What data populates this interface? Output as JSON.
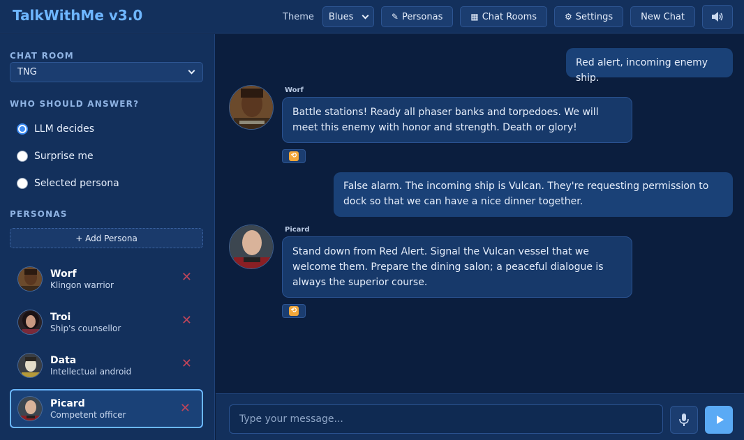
{
  "app": {
    "title": "TalkWithMe v3.0"
  },
  "header": {
    "theme_label": "Theme",
    "theme_value": "Blues",
    "personas_btn": "Personas",
    "chatrooms_btn": "Chat Rooms",
    "settings_btn": "Settings",
    "newchat_btn": "New Chat",
    "icons": {
      "personas": "pencil-icon",
      "chatrooms": "building-icon",
      "settings": "gear-icon",
      "sound": "speaker-icon"
    }
  },
  "sidebar": {
    "chat_room_title": "CHAT ROOM",
    "chat_room_value": "TNG",
    "who_title": "WHO SHOULD ANSWER?",
    "answer_options": [
      {
        "label": "LLM decides",
        "checked": true
      },
      {
        "label": "Surprise me",
        "checked": false
      },
      {
        "label": "Selected persona",
        "checked": false
      }
    ],
    "personas_title": "PERSONAS",
    "add_persona": "+ Add Persona",
    "personas": [
      {
        "name": "Worf",
        "desc": "Klingon warrior"
      },
      {
        "name": "Troi",
        "desc": "Ship's counsellor"
      },
      {
        "name": "Data",
        "desc": "Intellectual android"
      },
      {
        "name": "Picard",
        "desc": "Competent officer"
      }
    ],
    "remove_glyph": "✕"
  },
  "messages": [
    {
      "role": "user",
      "text": "Red alert, incoming enemy ship."
    },
    {
      "role": "bot",
      "sender": "Worf",
      "text": "Battle stations! Ready all phaser banks and torpedoes. We will meet this enemy with honor and strength. Death or glory!"
    },
    {
      "role": "user",
      "text": "False alarm. The incoming ship is Vulcan. They're requesting permission to dock so that we can have a nice dinner together."
    },
    {
      "role": "bot",
      "sender": "Picard",
      "text": "Stand down from Red Alert. Signal the Vulcan vessel that we welcome them. Prepare the dining salon; a peaceful dialogue is always the superior course."
    }
  ],
  "input": {
    "placeholder": "Type your message..."
  },
  "colors": {
    "accent": "#6eb6ff",
    "send": "#5aaaf5",
    "bg": "#0b1e3e",
    "panel": "#13305c",
    "danger": "#c0455a"
  }
}
